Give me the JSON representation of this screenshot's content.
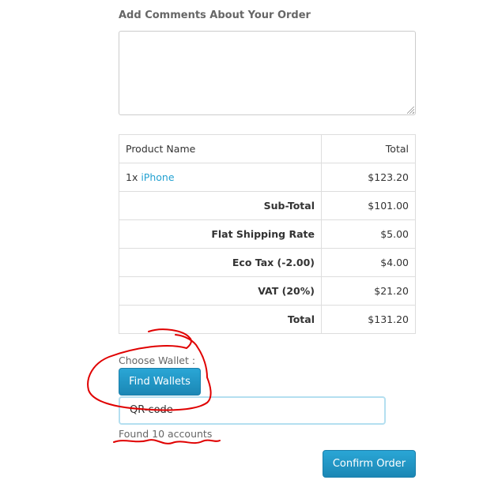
{
  "comments": {
    "title": "Add Comments About Your Order",
    "value": ""
  },
  "order_table": {
    "header": {
      "product": "Product Name",
      "total": "Total"
    },
    "item": {
      "qty": "1x ",
      "name": "iPhone",
      "price": "$123.20"
    },
    "rows": [
      {
        "label": "Sub-Total",
        "value": "$101.00"
      },
      {
        "label": "Flat Shipping Rate",
        "value": "$5.00"
      },
      {
        "label": "Eco Tax (-2.00)",
        "value": "$4.00"
      },
      {
        "label": "VAT (20%)",
        "value": "$21.20"
      },
      {
        "label": "Total",
        "value": "$131.20"
      }
    ]
  },
  "wallet": {
    "label": "Choose Wallet :",
    "find_button": "Find Wallets",
    "input_value": "QR-code",
    "found_text": "Found 10 accounts"
  },
  "confirm_button": "Confirm Order",
  "colors": {
    "accent": "#23a1d1",
    "button": "#1b87b5",
    "annotation": "#e00000"
  },
  "icons": [
    "resize-grip-icon"
  ]
}
